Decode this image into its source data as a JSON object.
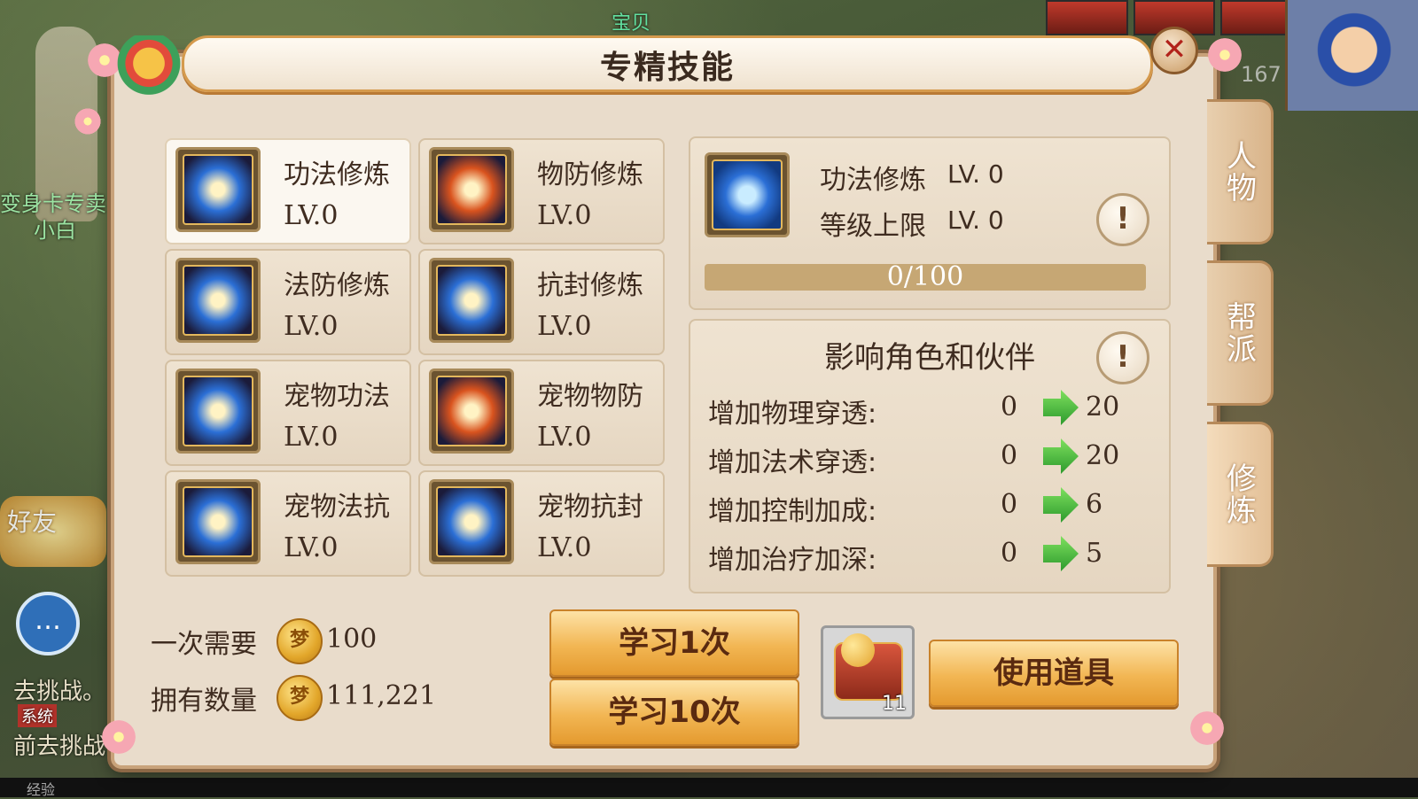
{
  "background": {
    "left_tag": "小白",
    "left_tag_top": "变身卡专卖",
    "treasure_label": "宝贝",
    "portrait_number": "167",
    "friend_label": "好友",
    "challenge_text_1": "去挑战。",
    "challenge_text_2": "前去挑战",
    "system_label": "系统",
    "exp_label": "经验"
  },
  "dialog": {
    "title": "专精技能",
    "close_icon": "close-icon"
  },
  "skills": [
    {
      "name": "功法修炼",
      "level": "LV.0",
      "icon": "qi-cultivation-icon",
      "color": "#2b6fd6",
      "selected": true
    },
    {
      "name": "物防修炼",
      "level": "LV.0",
      "icon": "physical-defense-icon",
      "color": "#d9531e",
      "selected": false
    },
    {
      "name": "法防修炼",
      "level": "LV.0",
      "icon": "magic-defense-icon",
      "color": "#2b6fd6",
      "selected": false
    },
    {
      "name": "抗封修炼",
      "level": "LV.0",
      "icon": "seal-resist-icon",
      "color": "#2b6fd6",
      "selected": false
    },
    {
      "name": "宠物功法",
      "level": "LV.0",
      "icon": "pet-qi-icon",
      "color": "#2b6fd6",
      "selected": false
    },
    {
      "name": "宠物物防",
      "level": "LV.0",
      "icon": "pet-physical-defense-icon",
      "color": "#d9531e",
      "selected": false
    },
    {
      "name": "宠物法抗",
      "level": "LV.0",
      "icon": "pet-magic-resist-icon",
      "color": "#2b6fd6",
      "selected": false
    },
    {
      "name": "宠物抗封",
      "level": "LV.0",
      "icon": "pet-seal-resist-icon",
      "color": "#2b6fd6",
      "selected": false
    }
  ],
  "detail": {
    "name": "功法修炼",
    "level": "LV. 0",
    "cap_label": "等级上限",
    "cap_level": "LV. 0",
    "progress_text": "0/100",
    "progress_fraction": 0
  },
  "effects": {
    "title": "影响角色和伙伴",
    "rows": [
      {
        "label": "增加物理穿透:",
        "from": "0",
        "to": "20"
      },
      {
        "label": "增加法术穿透:",
        "from": "0",
        "to": "20"
      },
      {
        "label": "增加控制加成:",
        "from": "0",
        "to": "6"
      },
      {
        "label": "增加治疗加深:",
        "from": "0",
        "to": "5"
      }
    ]
  },
  "cost": {
    "per_label": "一次需要",
    "per_value": "100",
    "owned_label": "拥有数量",
    "owned_value": "111,221",
    "coin_glyph": "梦"
  },
  "buttons": {
    "learn_once": "学习1次",
    "learn_ten": "学习10次",
    "use_item": "使用道具"
  },
  "item": {
    "count": "11",
    "icon": "treasure-chest-icon"
  },
  "side_tabs": [
    {
      "label": "人物",
      "active": false
    },
    {
      "label": "帮派",
      "active": false
    },
    {
      "label": "修炼",
      "active": true
    }
  ],
  "chat_icon": "chat-bubble-icon"
}
